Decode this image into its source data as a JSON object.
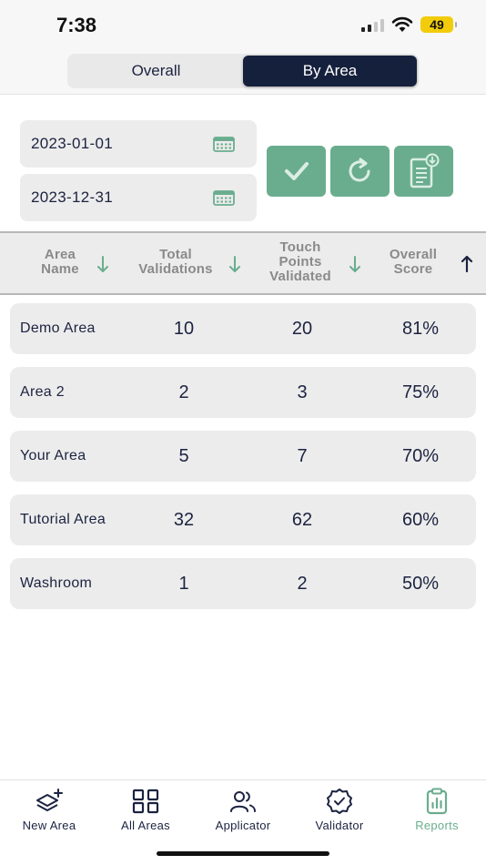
{
  "status": {
    "time": "7:38",
    "battery": "49"
  },
  "segmented": {
    "overall_label": "Overall",
    "by_area_label": "By Area",
    "selected": "By Area"
  },
  "filters": {
    "start_date": "2023-01-01",
    "end_date": "2023-12-31",
    "start_icon": "calendar-icon",
    "end_icon": "calendar-icon"
  },
  "actions": {
    "apply_icon": "checkmark-icon",
    "reset_icon": "refresh-icon",
    "export_icon": "document-download-icon"
  },
  "table": {
    "headers": {
      "area_name": "Area Name",
      "total_validations": "Total Validations",
      "touch_points": "Touch Points Validated",
      "overall_score": "Overall Score"
    },
    "rows": [
      {
        "name": "Demo Area",
        "total": "10",
        "touch": "20",
        "score": "81%"
      },
      {
        "name": "Area 2",
        "total": "2",
        "touch": "3",
        "score": "75%"
      },
      {
        "name": "Your Area",
        "total": "5",
        "touch": "7",
        "score": "70%"
      },
      {
        "name": "Tutorial Area",
        "total": "32",
        "touch": "62",
        "score": "60%"
      },
      {
        "name": "Washroom",
        "total": "1",
        "touch": "2",
        "score": "50%"
      }
    ]
  },
  "tabbar": {
    "items": [
      {
        "label": "New Area",
        "icon": "layers-plus-icon"
      },
      {
        "label": "All Areas",
        "icon": "grid-icon"
      },
      {
        "label": "Applicator",
        "icon": "users-icon"
      },
      {
        "label": "Validator",
        "icon": "badge-check-icon"
      },
      {
        "label": "Reports",
        "icon": "clipboard-chart-icon"
      }
    ],
    "active": "Reports"
  },
  "colors": {
    "accent": "#6aad8e",
    "navy": "#15203d",
    "row_bg": "#ececec"
  }
}
